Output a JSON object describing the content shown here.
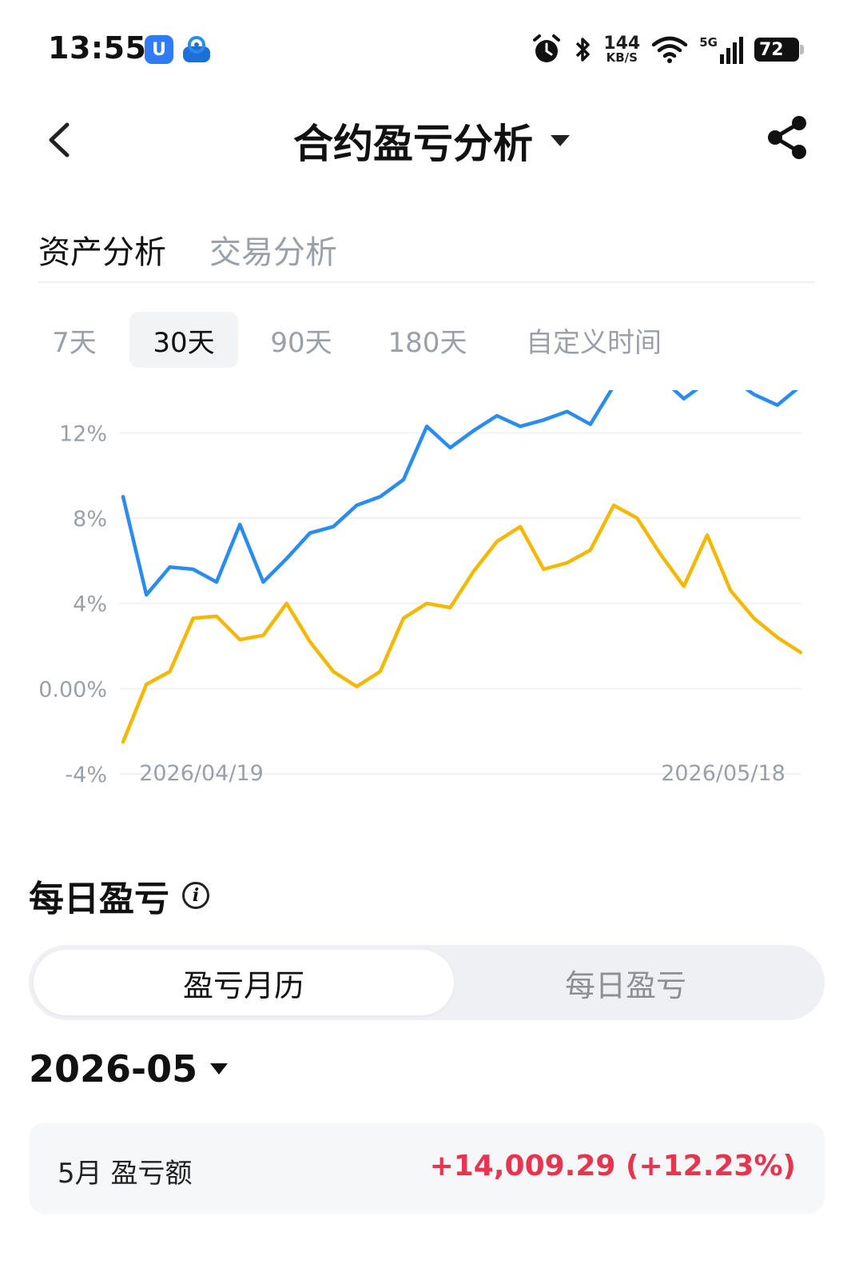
{
  "status_bar": {
    "time": "13:55",
    "app_icon_1": "U",
    "net_speed_value": "144",
    "net_speed_unit": "KB/S",
    "network": "5G",
    "battery": "72"
  },
  "header": {
    "title": "合约盈亏分析"
  },
  "tabs": {
    "asset": "资产分析",
    "trade": "交易分析"
  },
  "ranges": {
    "r7": "7天",
    "r30": "30天",
    "r90": "90天",
    "r180": "180天",
    "custom": "自定义时间",
    "selected": "30天"
  },
  "chart_data": {
    "type": "line",
    "ylim": [
      -4,
      14
    ],
    "y_ticks": [
      "12%",
      "8%",
      "4%",
      "0.00%",
      "-4%"
    ],
    "x_tick_labels": [
      "2026/04/19",
      "2026/05/18"
    ],
    "x_index": [
      0,
      1,
      2,
      3,
      4,
      5,
      6,
      7,
      8,
      9,
      10,
      11,
      12,
      13,
      14,
      15,
      16,
      17,
      18,
      19,
      20,
      21,
      22,
      23,
      24,
      25,
      26,
      27,
      28,
      29
    ],
    "series": [
      {
        "color": "#2a8cf0",
        "values": [
          9.0,
          4.4,
          5.7,
          5.6,
          5.0,
          7.7,
          5.0,
          6.1,
          7.3,
          7.6,
          8.6,
          9.0,
          9.8,
          12.3,
          11.3,
          12.1,
          12.8,
          12.3,
          12.6,
          13.0,
          12.4,
          14.2,
          14.6,
          14.6,
          13.6,
          14.4,
          14.6,
          13.8,
          13.3,
          14.2
        ]
      },
      {
        "color": "#f5b800",
        "values": [
          -2.5,
          0.2,
          0.8,
          3.3,
          3.4,
          2.3,
          2.5,
          4.0,
          2.2,
          0.8,
          0.1,
          0.8,
          3.3,
          4.0,
          3.8,
          5.5,
          6.9,
          7.6,
          5.6,
          5.9,
          6.5,
          8.6,
          8.0,
          6.3,
          4.8,
          7.2,
          4.6,
          3.3,
          2.4,
          1.7
        ]
      }
    ]
  },
  "daily_pnl": {
    "title": "每日盈亏",
    "info_icon": "i",
    "segment_calendar": "盈亏月历",
    "segment_daily": "每日盈亏",
    "month": "2026-05",
    "card_label": "5月 盈亏额",
    "card_value": "+14,009.29 (+12.23%)"
  }
}
